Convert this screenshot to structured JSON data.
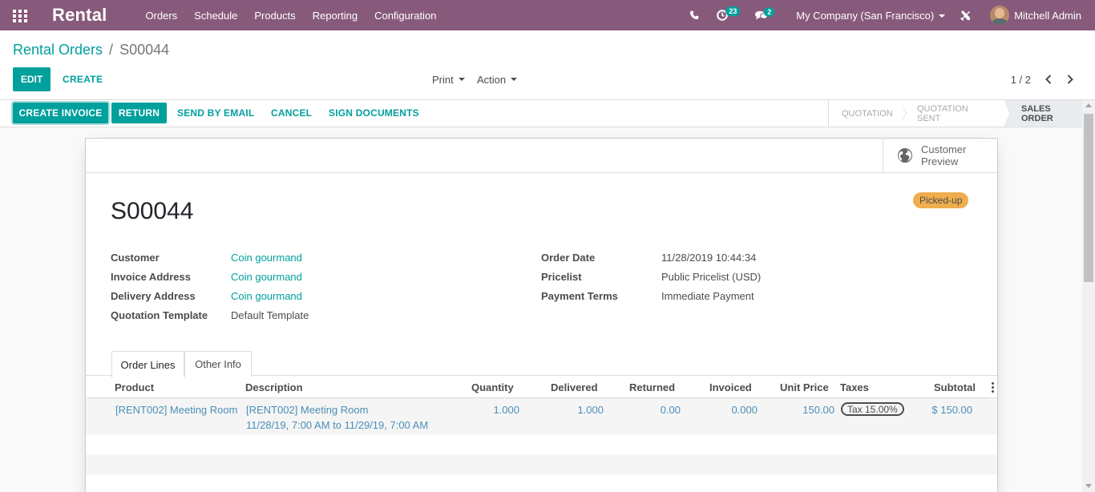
{
  "navbar": {
    "brand": "Rental",
    "menu": [
      "Orders",
      "Schedule",
      "Products",
      "Reporting",
      "Configuration"
    ],
    "activity_count": "23",
    "message_count": "2",
    "company": "My Company (San Francisco)",
    "user": "Mitchell Admin"
  },
  "control_panel": {
    "breadcrumb_parent": "Rental Orders",
    "breadcrumb_current": "S00044",
    "edit_label": "EDIT",
    "create_label": "CREATE",
    "print_label": "Print",
    "action_label": "Action",
    "pager": "1 / 2"
  },
  "statusbar": {
    "buttons": [
      "CREATE INVOICE",
      "RETURN",
      "SEND BY EMAIL",
      "CANCEL",
      "SIGN DOCUMENTS"
    ],
    "stages": [
      "QUOTATION",
      "QUOTATION SENT",
      "SALES ORDER"
    ],
    "active_stage": "SALES ORDER"
  },
  "form": {
    "preview_label": "Customer Preview",
    "title": "S00044",
    "ribbon": "Picked-up",
    "left_fields": [
      {
        "label": "Customer",
        "value": "Coin gourmand"
      },
      {
        "label": "Invoice Address",
        "value": "Coin gourmand"
      },
      {
        "label": "Delivery Address",
        "value": "Coin gourmand"
      },
      {
        "label": "Quotation Template",
        "value": "Default Template"
      }
    ],
    "right_fields": [
      {
        "label": "Order Date",
        "value": "11/28/2019 10:44:34"
      },
      {
        "label": "Pricelist",
        "value": "Public Pricelist (USD)"
      },
      {
        "label": "Payment Terms",
        "value": "Immediate Payment"
      }
    ],
    "tabs": [
      "Order Lines",
      "Other Info"
    ]
  },
  "order_lines": {
    "columns": [
      "Product",
      "Description",
      "Quantity",
      "Delivered",
      "Returned",
      "Invoiced",
      "Unit Price",
      "Taxes",
      "Subtotal"
    ],
    "rows": [
      {
        "product": "[RENT002] Meeting Room",
        "description_line1": "[RENT002] Meeting Room",
        "description_line2": "11/28/19, 7:00 AM to 11/29/19, 7:00 AM",
        "quantity": "1.000",
        "delivered": "1.000",
        "returned": "0.00",
        "invoiced": "0.000",
        "unit_price": "150.00",
        "taxes": "Tax 15.00%",
        "subtotal": "$ 150.00"
      }
    ]
  },
  "colors": {
    "brand": "#875a7b",
    "accent": "#00a09d",
    "ribbon": "#f0ad4e"
  }
}
